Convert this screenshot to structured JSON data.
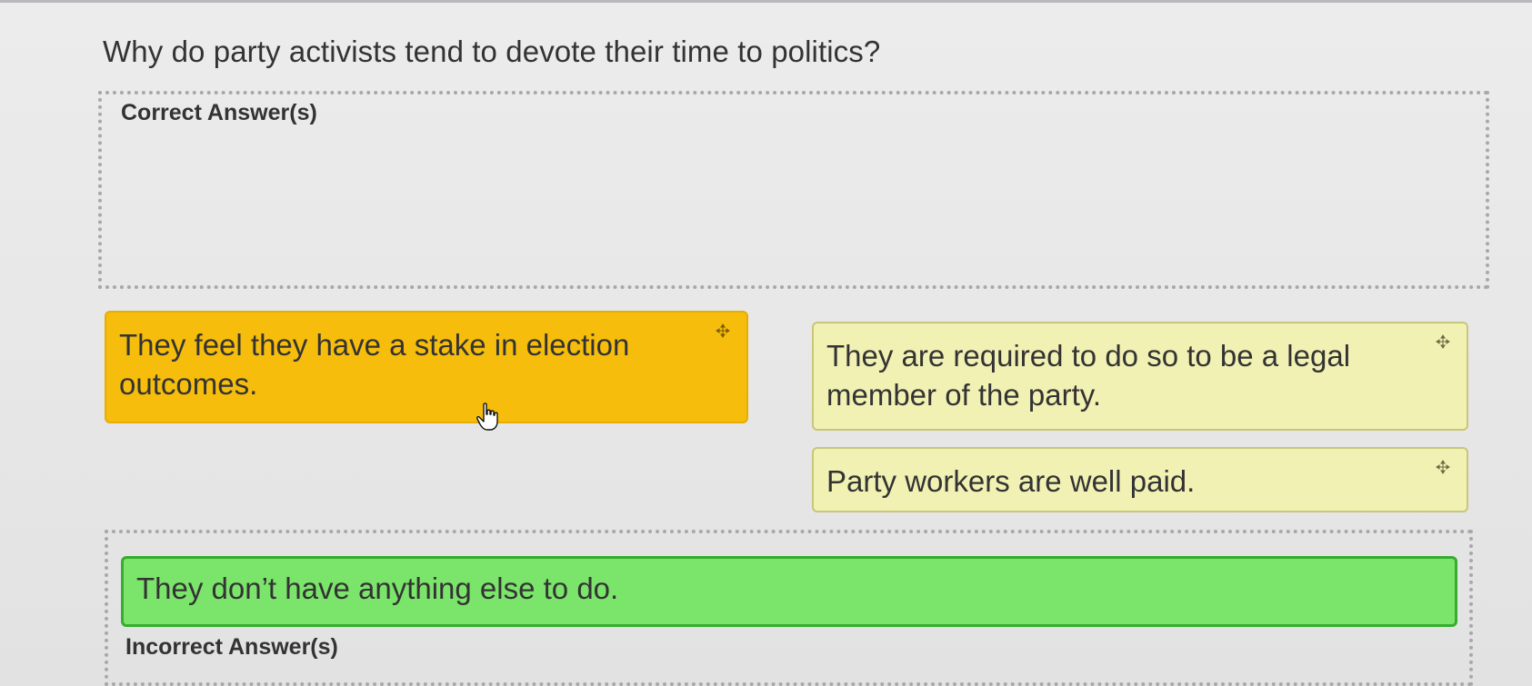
{
  "question": "Why do party activists tend to devote their time to politics?",
  "correct_zone": {
    "label": "Correct Answer(s)"
  },
  "incorrect_zone": {
    "label": "Incorrect Answer(s)"
  },
  "answers": [
    {
      "text": "They feel they have a stake in election outcomes.",
      "state": "selected",
      "color": "#f6bd0c",
      "icon": "move-icon"
    },
    {
      "text": "They are required to do so to be a legal member of the party.",
      "state": "unplaced",
      "color": "#f2f1b4",
      "icon": "move-icon"
    },
    {
      "text": "Party workers are well paid.",
      "state": "unplaced",
      "color": "#f2f1b4",
      "icon": "move-icon"
    },
    {
      "text": "They don’t have anything else to do.",
      "state": "placed-incorrect-zone",
      "color": "#7be56b"
    }
  ],
  "cursor": {
    "icon": "hand-pointer-icon"
  }
}
